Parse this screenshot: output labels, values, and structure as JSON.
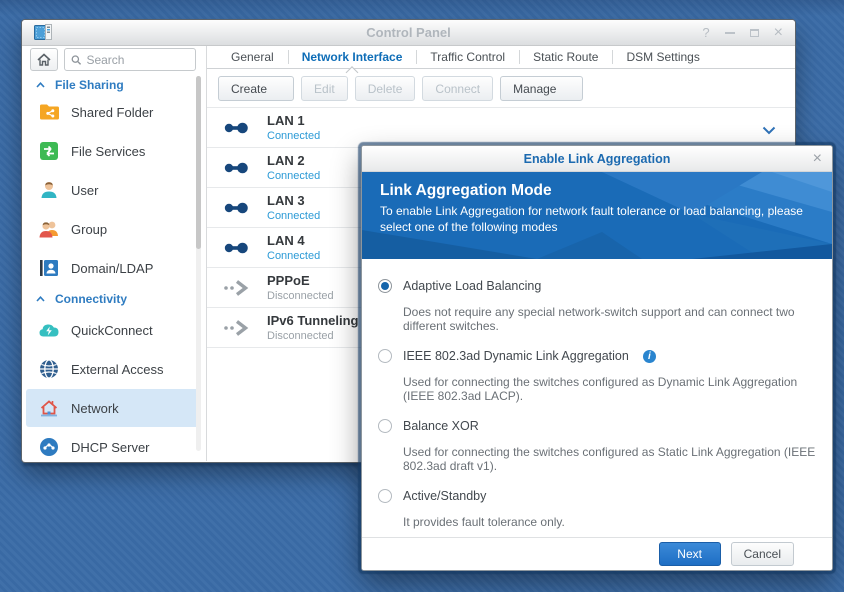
{
  "window": {
    "title": "Control Panel",
    "controls": {
      "help": "?",
      "close": "×"
    }
  },
  "sidebar": {
    "search": {
      "placeholder": "Search"
    },
    "sections": [
      {
        "label": "File Sharing",
        "items": [
          {
            "label": "Shared Folder",
            "icon": "shared-folder-icon"
          },
          {
            "label": "File Services",
            "icon": "file-services-icon"
          },
          {
            "label": "User",
            "icon": "user-icon"
          },
          {
            "label": "Group",
            "icon": "group-icon"
          },
          {
            "label": "Domain/LDAP",
            "icon": "domain-ldap-icon"
          }
        ]
      },
      {
        "label": "Connectivity",
        "items": [
          {
            "label": "QuickConnect",
            "icon": "quickconnect-icon"
          },
          {
            "label": "External Access",
            "icon": "external-access-icon"
          },
          {
            "label": "Network",
            "icon": "network-icon",
            "selected": true
          },
          {
            "label": "DHCP Server",
            "icon": "dhcp-server-icon"
          }
        ]
      }
    ]
  },
  "tabs": [
    {
      "label": "General",
      "active": false
    },
    {
      "label": "Network Interface",
      "active": true
    },
    {
      "label": "Traffic Control",
      "active": false
    },
    {
      "label": "Static Route",
      "active": false
    },
    {
      "label": "DSM Settings",
      "active": false
    }
  ],
  "toolbar": {
    "create": "Create",
    "edit": "Edit",
    "delete": "Delete",
    "connect": "Connect",
    "manage": "Manage"
  },
  "interfaces": [
    {
      "name": "LAN 1",
      "status": "Connected",
      "state": "connected"
    },
    {
      "name": "LAN 2",
      "status": "Connected",
      "state": "connected"
    },
    {
      "name": "LAN 3",
      "status": "Connected",
      "state": "connected"
    },
    {
      "name": "LAN 4",
      "status": "Connected",
      "state": "connected"
    },
    {
      "name": "PPPoE",
      "status": "Disconnected",
      "state": "disconnected"
    },
    {
      "name": "IPv6 Tunneling",
      "status": "Disconnected",
      "state": "disconnected"
    }
  ],
  "dialog": {
    "title": "Enable Link Aggregation",
    "close": "×",
    "heading": "Link Aggregation Mode",
    "description": "To enable Link Aggregation for network fault tolerance or load balancing, please select one of the following modes",
    "options": [
      {
        "label": "Adaptive Load Balancing",
        "description": "Does not require any special network-switch support and can connect two different switches.",
        "selected": true
      },
      {
        "label": "IEEE 802.3ad Dynamic Link Aggregation",
        "description": "Used for connecting the switches configured as Dynamic Link Aggregation (IEEE 802.3ad LACP).",
        "info": true
      },
      {
        "label": "Balance XOR",
        "description": "Used for connecting the switches configured as Static Link Aggregation (IEEE 802.3ad draft v1)."
      },
      {
        "label": "Active/Standby",
        "description": "It provides fault tolerance only."
      }
    ],
    "info_glyph": "i",
    "buttons": {
      "next": "Next",
      "cancel": "Cancel"
    }
  },
  "colors": {
    "accent": "#1a6bb7",
    "connected_text": "#2b9ad6",
    "disconnected_text": "#9aa1a7",
    "selected_item_bg": "#d5e7f7",
    "active_tab_text": "#0e6db7"
  }
}
